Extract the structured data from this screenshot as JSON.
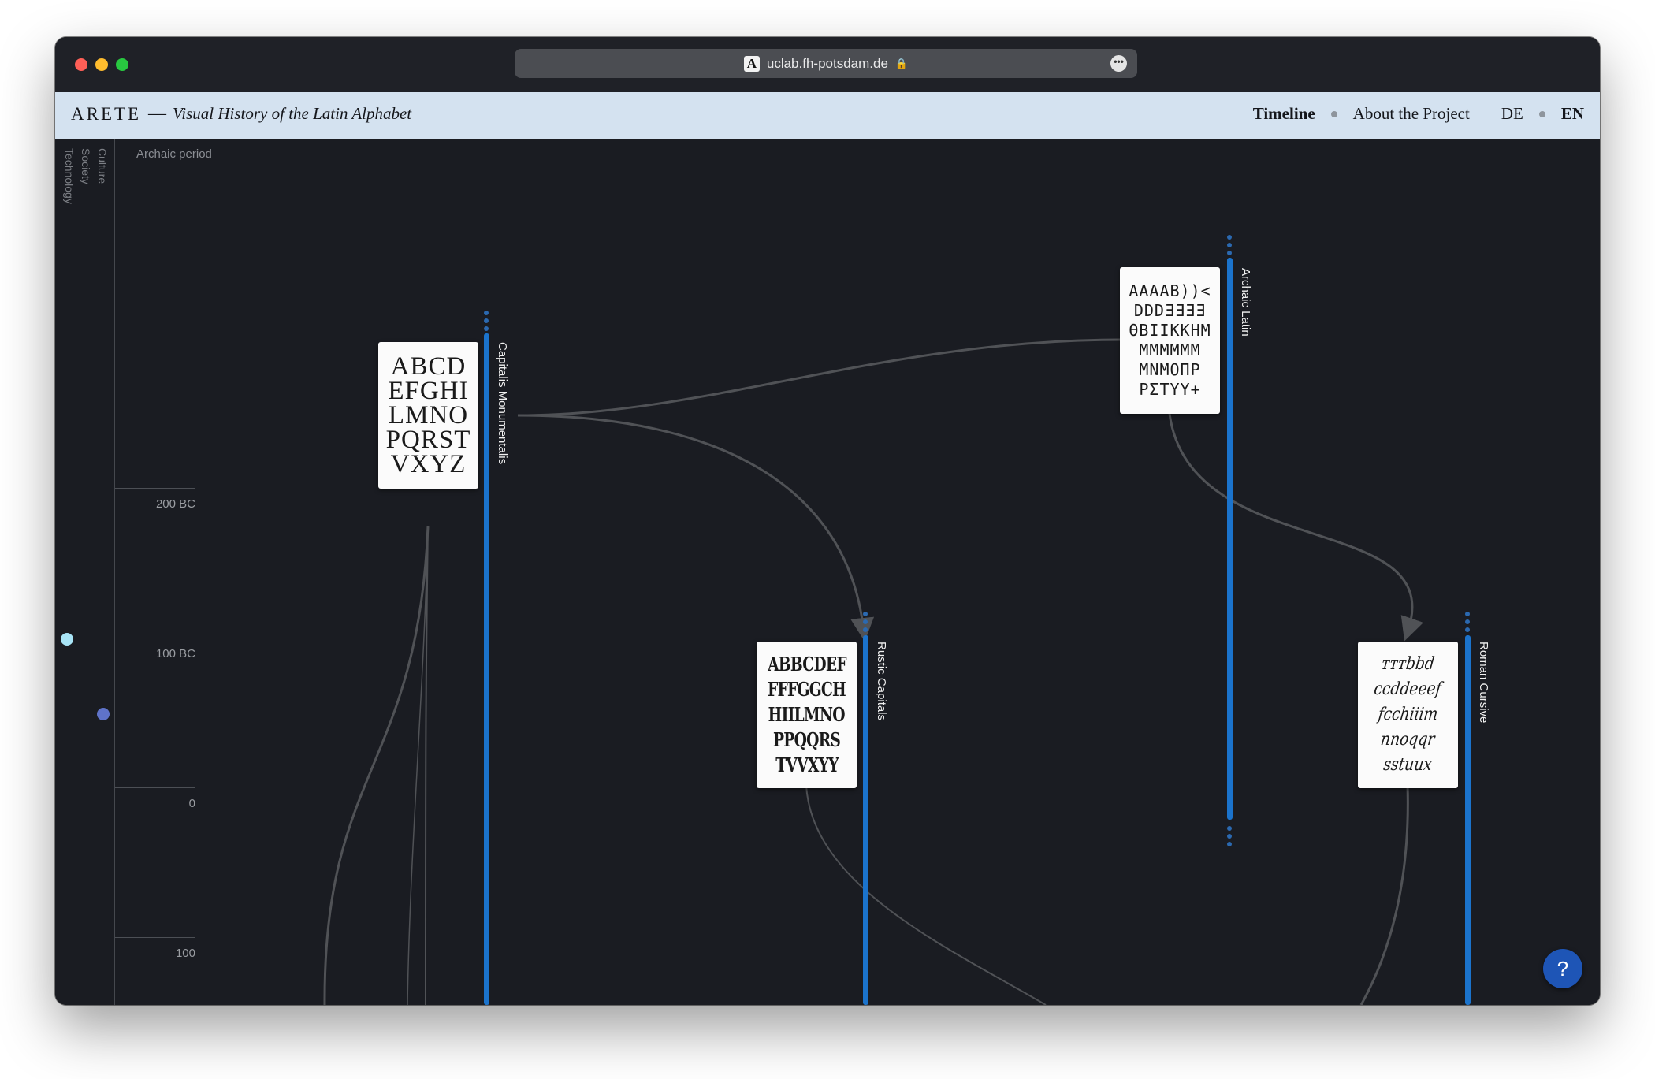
{
  "browser": {
    "url": "uclab.fh-potsdam.de",
    "site_icon": "A",
    "lock_icon": "🔒",
    "more_icon": "•••"
  },
  "header": {
    "brand": "ARETE",
    "dash": "—",
    "tagline": "Visual History of the Latin Alphabet",
    "nav": {
      "timeline": "Timeline",
      "about": "About the Project",
      "lang_de": "DE",
      "lang_en": "EN"
    }
  },
  "sidebar": {
    "categories": [
      "Culture",
      "Society",
      "Technology"
    ],
    "event_colors": [
      "#a8e4f6",
      "#5f73c9"
    ]
  },
  "timeline": {
    "period": "Archaic period",
    "ticks": [
      "200 BC",
      "100 BC",
      "0",
      "100"
    ]
  },
  "scripts": [
    {
      "name": "Capitalis Monumentalis",
      "glyphs": [
        "ABCD",
        "EFGHI",
        "LMNO",
        "PQRST",
        "VXYZ"
      ]
    },
    {
      "name": "Rustic Capitals",
      "glyphs": [
        "ABBCDEF",
        "FFFGGCH",
        "HIILMNO",
        "PPQQRS",
        "TVVXYY"
      ]
    },
    {
      "name": "Archaic Latin",
      "glyphs": [
        "AAAAB))<",
        "DDDƎƎƎƎ",
        "ӨBIIKKHM",
        "ΜΜΜΜΜΜ",
        "ΜΝΜΟΠΡ",
        "ΡΣΤΥΥ+"
      ]
    },
    {
      "name": "Roman Cursive",
      "glyphs": [
        "ᴛᴛᴛbbd",
        "ccddeeef",
        "fcchiiim",
        "nnoqqr",
        "sstuux"
      ]
    }
  ],
  "colors": {
    "background": "#1a1c22",
    "header_bg": "#d4e2f0",
    "track_blue": "#1b73cc",
    "connector": "#505256",
    "help_button": "#1e55b6"
  },
  "help": {
    "label": "?"
  }
}
